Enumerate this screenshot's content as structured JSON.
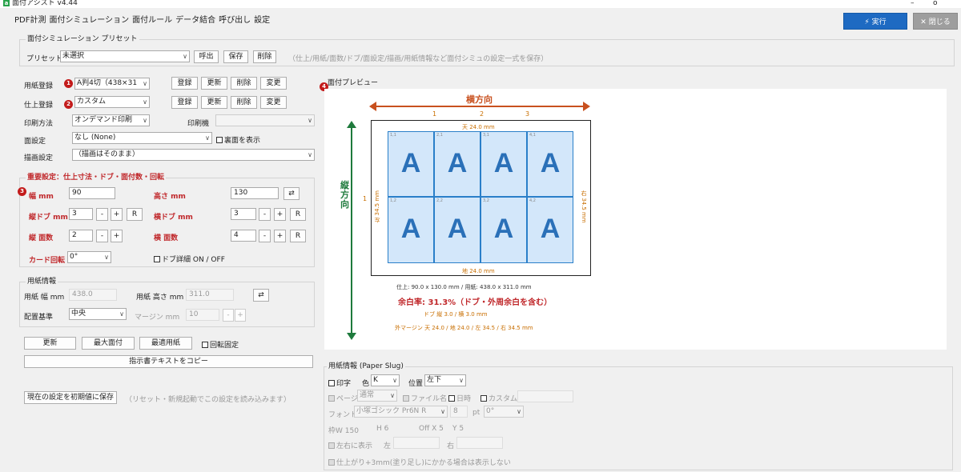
{
  "app": {
    "title": "面付アシスト v4.44",
    "icon_letter": "a",
    "minimize": "–",
    "restore": "ö"
  },
  "menu": [
    "PDF計測",
    "面付シミュレーション",
    "面付ルール",
    "データ結合",
    "呼び出し",
    "設定"
  ],
  "actions": {
    "execute": "⚡ 実行",
    "close": "✕ 閉じる"
  },
  "preset": {
    "group_title": "面付シミュレーション プリセット",
    "label": "プリセット",
    "selected": "未選択",
    "buttons": [
      "呼出",
      "保存",
      "削除"
    ],
    "note": "（仕上/用紙/面数/ドブ/面設定/描画/用紙情報など面付シミュの設定一式を保存）"
  },
  "form": {
    "paper_reg": {
      "label": "用紙登録",
      "badge": "1",
      "value": "A判4切（438×31",
      "buttons": [
        "登録",
        "更新",
        "削除",
        "変更"
      ]
    },
    "finish_reg": {
      "label": "仕上登録",
      "badge": "2",
      "value": "カスタム",
      "buttons": [
        "登録",
        "更新",
        "削除",
        "変更"
      ]
    },
    "print_method": {
      "label": "印刷方法",
      "value": "オンデマンド印刷"
    },
    "printer": {
      "label": "印刷機",
      "value": ""
    },
    "face": {
      "label": "面設定",
      "value": "なし (None)",
      "show_back": "裏面を表示"
    },
    "draw": {
      "label": "描画設定",
      "value": "（描画はそのまま）"
    }
  },
  "important": {
    "title": "重要設定：仕上寸法・ドブ・面付数・回転",
    "badge": "3",
    "width_label": "幅 mm",
    "width": "90",
    "height_label": "高さ mm",
    "height": "130",
    "swap": "⇄",
    "vdobu_label": "縦ドブ mm",
    "vdobu": "3",
    "hdobu_label": "横ドブ mm",
    "hdobu": "3",
    "vcount_label": "縦 面数",
    "vcount": "2",
    "hcount_label": "横 面数",
    "hcount": "4",
    "minus": "-",
    "plus": "+",
    "reset": "R",
    "rotate_label": "カード回転",
    "rotate": "0°",
    "dobu_detail": "ドブ詳細 ON / OFF"
  },
  "paperinfo": {
    "title": "用紙情報",
    "width_label": "用紙 幅 mm",
    "width": "438.0",
    "height_label": "用紙 高さ mm",
    "height": "311.0",
    "align_label": "配置基準",
    "align": "中央",
    "margin_label": "マージン mm",
    "margin": "10"
  },
  "bottom_buttons": {
    "update": "更新",
    "max_faces": "最大面付",
    "best_paper": "最適用紙",
    "rotate_fixed": "回転固定"
  },
  "copy_button": "指示書テキストをコピー",
  "default_button": "現在の設定を初期値に保存",
  "default_note": "（リセット・新規起動でこの設定を読み込みます）",
  "preview": {
    "title": "面付プレビュー",
    "badge": "4",
    "horizontal": "横方向",
    "vertical": "縦方向",
    "col_numbers": [
      "1",
      "2",
      "3"
    ],
    "row_number": "1",
    "top": "天 24.0 mm",
    "bottom": "地 24.0 mm",
    "left": "左 34.5 mm",
    "right": "右 34.5 mm",
    "cell_letter": "A",
    "cells": [
      [
        "1,1",
        "2,1",
        "3,1",
        "4,1"
      ],
      [
        "1,2",
        "2,2",
        "3,2",
        "4,2"
      ]
    ],
    "summary": "仕上: 90.0 x 130.0 mm / 用紙: 438.0 x 311.0 mm",
    "margin_ratio": "余白率: 31.3%（ドブ・外周余白を含む）",
    "dobu": "ドブ 縦 3.0 / 横 3.0 mm",
    "outer": "外マージン 天 24.0 / 地 24.0 / 左 34.5 / 右 34.5 mm",
    "arrow_color": "#c8501e",
    "vertical_color": "#1e7a3c"
  },
  "slug": {
    "title": "用紙情報 (Paper Slug)",
    "print_label": "印字",
    "color_label": "色",
    "color": "K",
    "pos_label": "位置",
    "pos": "左下",
    "page_label": "ページ",
    "page_value": "通常",
    "filename": "ファイル名",
    "datetime": "日時",
    "custom": "カスタム",
    "font_label": "フォント",
    "font": "小塚ゴシック Pr6N R",
    "size": "8",
    "pt": "pt",
    "angle": "0°",
    "frame": "枠W 150",
    "h": "H 6",
    "offx": "Off X 5",
    "y": "Y 5",
    "lr_label": "左右に表示",
    "left": "左",
    "right": "右",
    "note": "仕上がり+3mm(塗り足し)にかかる場合は表示しない"
  }
}
